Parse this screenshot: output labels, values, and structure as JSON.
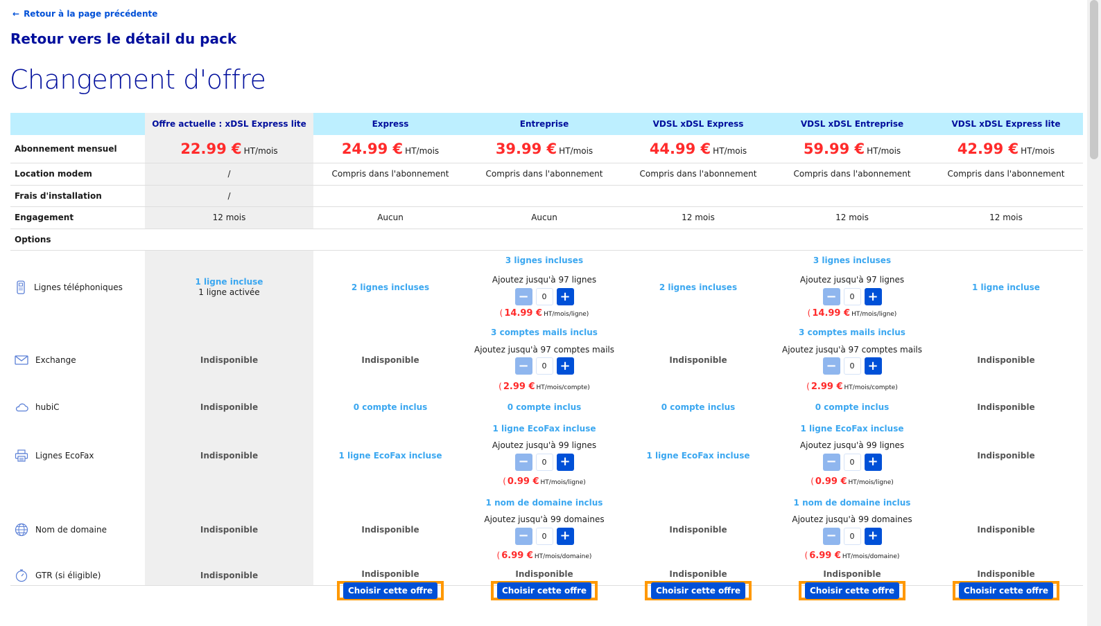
{
  "nav": {
    "back_arrow": "←",
    "back_label": "Retour à la page précédente",
    "pack_label": "Retour vers le détail du pack",
    "page_title": "Changement d'offre"
  },
  "columns": [
    {
      "title": "Offre actuelle : xDSL Express lite",
      "price": "22.99 €",
      "price_unit": "HT/mois",
      "modem": "/",
      "install": "/",
      "engagement": "12 mois"
    },
    {
      "title": "Express",
      "price": "24.99 €",
      "price_unit": "HT/mois",
      "modem": "Compris dans l'abonnement",
      "install": "",
      "engagement": "Aucun"
    },
    {
      "title": "Entreprise",
      "price": "39.99 €",
      "price_unit": "HT/mois",
      "modem": "Compris dans l'abonnement",
      "install": "",
      "engagement": "Aucun"
    },
    {
      "title": "VDSL xDSL Express",
      "price": "44.99 €",
      "price_unit": "HT/mois",
      "modem": "Compris dans l'abonnement",
      "install": "",
      "engagement": "12 mois"
    },
    {
      "title": "VDSL xDSL Entreprise",
      "price": "59.99 €",
      "price_unit": "HT/mois",
      "modem": "Compris dans l'abonnement",
      "install": "",
      "engagement": "12 mois"
    },
    {
      "title": "VDSL xDSL Express lite",
      "price": "42.99 €",
      "price_unit": "HT/mois",
      "modem": "Compris dans l'abonnement",
      "install": "",
      "engagement": "12 mois"
    }
  ],
  "row_labels": {
    "price": "Abonnement mensuel",
    "modem": "Location modem",
    "install": "Frais d'installation",
    "engagement": "Engagement",
    "options": "Options"
  },
  "options": {
    "lignes": {
      "label": "Lignes téléphoniques",
      "icon": "phone-icon",
      "current_incl": "1 ligne incluse",
      "current_active": "1 ligne activée",
      "express": "2 lignes incluses",
      "vdsl_express": "2 lignes incluses",
      "vdsl_express_lite": "1 ligne incluse",
      "entreprise": {
        "incl": "3 lignes incluses",
        "add": "Ajoutez jusqu'à 97 lignes",
        "qty": "0",
        "paren": "(",
        "amt": "14.99 €",
        "unit": "HT/mois/ligne)"
      },
      "vdsl_entreprise": {
        "incl": "3 lignes incluses",
        "add": "Ajoutez jusqu'à 97 lignes",
        "qty": "0",
        "paren": "(",
        "amt": "14.99 €",
        "unit": "HT/mois/ligne)"
      }
    },
    "exchange": {
      "label": "Exchange",
      "icon": "mail-icon",
      "unavailable": "Indisponible",
      "entreprise": {
        "incl": "3 comptes mails inclus",
        "add": "Ajoutez jusqu'à 97 comptes mails",
        "qty": "0",
        "paren": "(",
        "amt": "2.99 €",
        "unit": "HT/mois/compte)"
      },
      "vdsl_entreprise": {
        "incl": "3 comptes mails inclus",
        "add": "Ajoutez jusqu'à 97 comptes mails",
        "qty": "0",
        "paren": "(",
        "amt": "2.99 €",
        "unit": "HT/mois/compte)"
      }
    },
    "hubic": {
      "label": "hubiC",
      "icon": "cloud-icon",
      "unavailable": "Indisponible",
      "included": "0 compte inclus"
    },
    "ecofax": {
      "label": "Lignes EcoFax",
      "icon": "printer-icon",
      "unavailable": "Indisponible",
      "included": "1 ligne EcoFax incluse",
      "entreprise": {
        "incl": "1 ligne EcoFax incluse",
        "add": "Ajoutez jusqu'à 99 lignes",
        "qty": "0",
        "paren": "(",
        "amt": "0.99 €",
        "unit": "HT/mois/ligne)"
      },
      "vdsl_entreprise": {
        "incl": "1 ligne EcoFax incluse",
        "add": "Ajoutez jusqu'à 99 lignes",
        "qty": "0",
        "paren": "(",
        "amt": "0.99 €",
        "unit": "HT/mois/ligne)"
      }
    },
    "domain": {
      "label": "Nom de domaine",
      "icon": "globe-icon",
      "unavailable": "Indisponible",
      "entreprise": {
        "incl": "1 nom de domaine inclus",
        "add": "Ajoutez jusqu'à 99 domaines",
        "qty": "0",
        "paren": "(",
        "amt": "6.99 €",
        "unit": "HT/mois/domaine)"
      },
      "vdsl_entreprise": {
        "incl": "1 nom de domaine inclus",
        "add": "Ajoutez jusqu'à 99 domaines",
        "qty": "0",
        "paren": "(",
        "amt": "6.99 €",
        "unit": "HT/mois/domaine)"
      }
    },
    "gtr": {
      "label": "GTR (si éligible)",
      "icon": "gauge-icon",
      "unavailable": "Indisponible"
    }
  },
  "stepper": {
    "minus": "−",
    "plus": "+"
  },
  "choose_label": "Choisir cette offre",
  "colors": {
    "accent": "#0050d7",
    "header_bg": "#bdefff",
    "price": "#ff2b2b",
    "highlight": "#ff9800",
    "included": "#3ba7f0"
  }
}
